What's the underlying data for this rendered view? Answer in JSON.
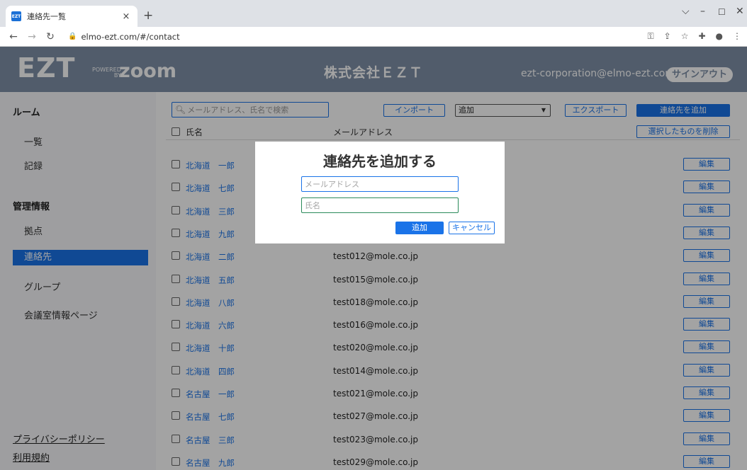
{
  "browser": {
    "tab_title": "連絡先一覧",
    "favicon_text": "EZT",
    "url": "elmo-ezt.com/#/contact"
  },
  "header": {
    "logo": "EZT",
    "powered": "POWERED",
    "by": "BY",
    "zoom": "zoom",
    "company": "株式会社ＥＺＴ",
    "email": "ezt-corporation@elmo-ezt.com",
    "signout_label": "サインアウト"
  },
  "sidebar": {
    "room_heading": "ルーム",
    "room_items": [
      "一覧",
      "記録"
    ],
    "admin_heading": "管理情報",
    "admin_items": [
      "拠点",
      "連絡先",
      "グループ",
      "会議室情報ページ"
    ],
    "active_item": "連絡先",
    "privacy_link": "プライバシーポリシー",
    "terms_link": "利用規約"
  },
  "toolbar": {
    "search_placeholder": "メールアドレス、氏名で検索",
    "import_label": "インポート",
    "mode_select_value": "追加",
    "export_label": "エクスポート",
    "add_contact_label": "連絡先を追加",
    "delete_selected_label": "選択したものを削除"
  },
  "table": {
    "col_name": "氏名",
    "col_email": "メールアドレス",
    "edit_label": "編集",
    "rows": [
      {
        "name": "北海道　一郎",
        "email": ""
      },
      {
        "name": "北海道　七郎",
        "email": ""
      },
      {
        "name": "北海道　三郎",
        "email": ""
      },
      {
        "name": "北海道　九郎",
        "email": ""
      },
      {
        "name": "北海道　二郎",
        "email": "test012@mole.co.jp"
      },
      {
        "name": "北海道　五郎",
        "email": "test015@mole.co.jp"
      },
      {
        "name": "北海道　八郎",
        "email": "test018@mole.co.jp"
      },
      {
        "name": "北海道　六郎",
        "email": "test016@mole.co.jp"
      },
      {
        "name": "北海道　十郎",
        "email": "test020@mole.co.jp"
      },
      {
        "name": "北海道　四郎",
        "email": "test014@mole.co.jp"
      },
      {
        "name": "名古屋　一郎",
        "email": "test021@mole.co.jp"
      },
      {
        "name": "名古屋　七郎",
        "email": "test027@mole.co.jp"
      },
      {
        "name": "名古屋　三郎",
        "email": "test023@mole.co.jp"
      },
      {
        "name": "名古屋　九郎",
        "email": "test029@mole.co.jp"
      }
    ]
  },
  "dialog": {
    "title": "連絡先を追加する",
    "email_placeholder": "メールアドレス",
    "name_placeholder": "氏名",
    "add_label": "追加",
    "cancel_label": "キャンセル"
  },
  "colors": {
    "accent": "#1a73e8",
    "header_bg": "#7f91a8"
  }
}
